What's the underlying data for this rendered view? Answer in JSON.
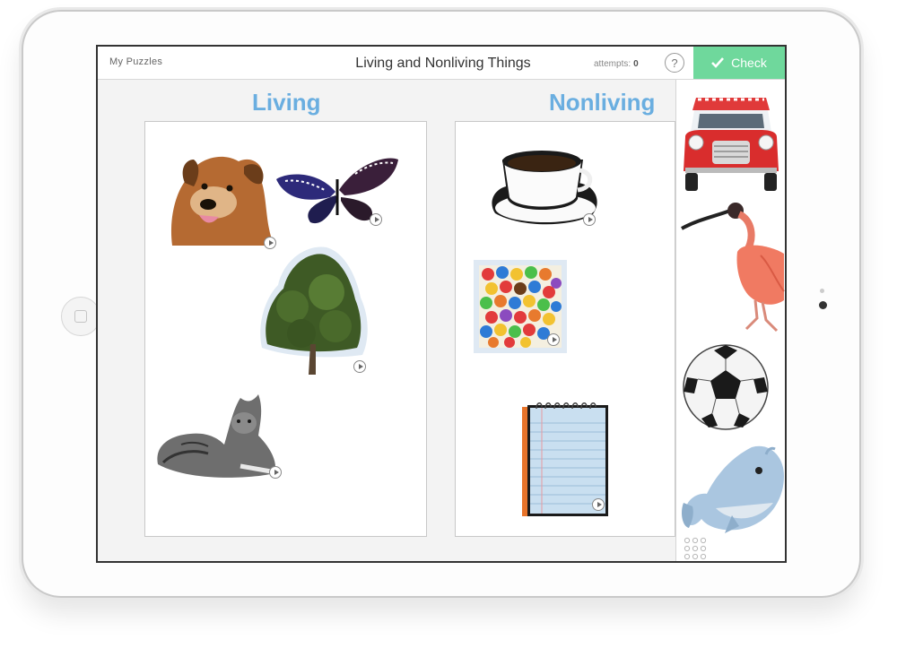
{
  "header": {
    "back_label": "My Puzzles",
    "title": "Living and Nonliving Things",
    "attempts_label": "attempts:",
    "attempts_value": "0",
    "help_label": "?",
    "check_label": "Check"
  },
  "categories": [
    {
      "label": "Living"
    },
    {
      "label": "Nonliving"
    }
  ],
  "living_items": [
    "dog",
    "butterfly",
    "tree",
    "cat"
  ],
  "nonliving_items": [
    "coffee cup",
    "candies",
    "notepad"
  ],
  "tray_items": [
    "car",
    "ibis bird",
    "soccer ball",
    "plush whale"
  ],
  "colors": {
    "accent_blue": "#6aaee0",
    "check_green": "#6fd89c",
    "board_bg": "#f3f3f3"
  },
  "icons": {
    "check": "checkmark-icon",
    "help": "question-mark-icon",
    "play": "play-icon",
    "menu": "grid-dots-icon"
  }
}
